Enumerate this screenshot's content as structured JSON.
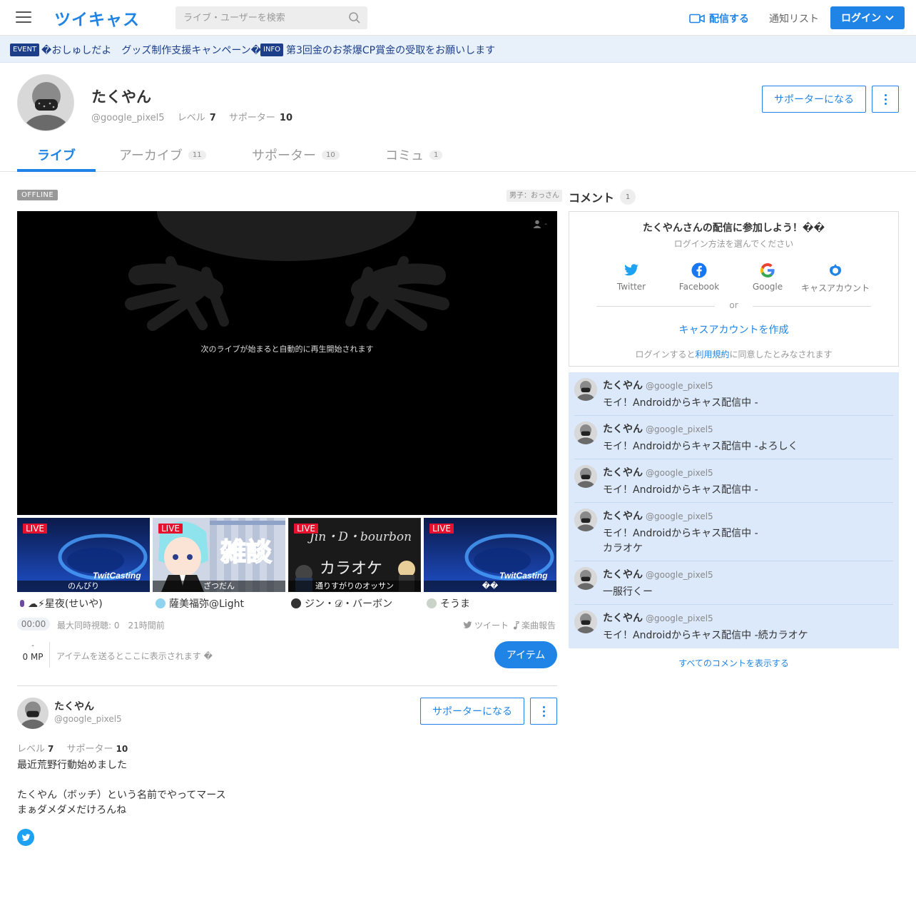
{
  "header": {
    "logo": "ツイキャス",
    "search_placeholder": "ライブ・ユーザーを検索",
    "broadcast_label": "配信する",
    "notice_list_label": "通知リスト",
    "login_label": "ログイン"
  },
  "notices": [
    {
      "tag": "EVENT",
      "text": "�おしゅしだよ　グッズ制作支援キャンペーン�"
    },
    {
      "tag": "INFO",
      "text": "第3回金のお茶爆CP賞金の受取をお願いします"
    }
  ],
  "profile": {
    "name": "たくやん",
    "handle": "@google_pixel5",
    "level_label": "レベル",
    "level": "7",
    "supporter_label": "サポーター",
    "supporters": "10",
    "become_supporter_label": "サポーターになる"
  },
  "tabs": [
    {
      "label": "ライブ",
      "count": ""
    },
    {
      "label": "アーカイブ",
      "count": "11"
    },
    {
      "label": "サポーター",
      "count": "10"
    },
    {
      "label": "コミュ",
      "count": "1"
    }
  ],
  "player": {
    "status": "OFFLINE",
    "category": "男子：おっさん",
    "viewer_count": "-",
    "message": "次のライブが始まると自動的に再生開始されます"
  },
  "live_cards": [
    {
      "badge": "LIVE",
      "caption": "のんびり",
      "user": "☁︎⚡︎星夜(せいや)"
    },
    {
      "badge": "LIVE",
      "caption": "ざつだん",
      "user": "薩美福弥@Light"
    },
    {
      "badge": "LIVE",
      "caption": "通りすがりのオッサン",
      "user": "ジン・𝒟・バーボン"
    },
    {
      "badge": "LIVE",
      "caption": "��",
      "user": "そうま"
    }
  ],
  "thumbnail_texts": {
    "twitcasting": "TwitCasting",
    "zatsudan": "雑談",
    "karaoke": "カラオケ",
    "jin_bourbon": "Jin・D・bourbon"
  },
  "stats": {
    "time": "00:00",
    "viewers": "最大同時視聴: 0　21時間前",
    "tweet_label": "ツイート",
    "music_label": "楽曲報告"
  },
  "items": {
    "mp_dash": "-",
    "mp_value": "0 MP",
    "placeholder": "アイテムを送るとここに表示されます �",
    "button_label": "アイテム"
  },
  "bottom_profile": {
    "name": "たくやん",
    "handle": "@google_pixel5",
    "level_label": "レベル",
    "level": "7",
    "supporter_label": "サポーター",
    "supporters": "10",
    "bio": "最近荒野行動始めました\n\nたくやん（ボッチ）という名前でやってマース\nまぁダメダメだけろんね",
    "become_supporter_label": "サポーターになる"
  },
  "comments_panel": {
    "title": "コメント",
    "count": "1",
    "login_title": "たくやんさんの配信に参加しよう！��",
    "login_subtitle": "ログイン方法を選んでください",
    "options": [
      "Twitter",
      "Facebook",
      "Google",
      "キャスアカウント"
    ],
    "or": "or",
    "create_account": "キャスアカウントを作成",
    "terms_prefix": "ログインすると",
    "terms_link": "利用規約",
    "terms_suffix": "に同意したとみなされます",
    "show_all": "すべてのコメントを表示する"
  },
  "comments": [
    {
      "name": "たくやん",
      "handle": "@google_pixel5",
      "text": "モイ！Androidからキャス配信中 -"
    },
    {
      "name": "たくやん",
      "handle": "@google_pixel5",
      "text": "モイ！Androidからキャス配信中 -よろしく"
    },
    {
      "name": "たくやん",
      "handle": "@google_pixel5",
      "text": "モイ！Androidからキャス配信中 -"
    },
    {
      "name": "たくやん",
      "handle": "@google_pixel5",
      "text": "モイ！Androidからキャス配信中 -\nカラオケ"
    },
    {
      "name": "たくやん",
      "handle": "@google_pixel5",
      "text": "一服行くー"
    },
    {
      "name": "たくやん",
      "handle": "@google_pixel5",
      "text": "モイ！Androidからキャス配信中 -続カラオケ"
    }
  ],
  "colors": {
    "accent": "#1f84e6",
    "live_red": "#e8112d",
    "notice_bg": "#e8f0fa",
    "comment_bg": "#dbe9fb",
    "notice_tag": "#1d3f8a"
  }
}
